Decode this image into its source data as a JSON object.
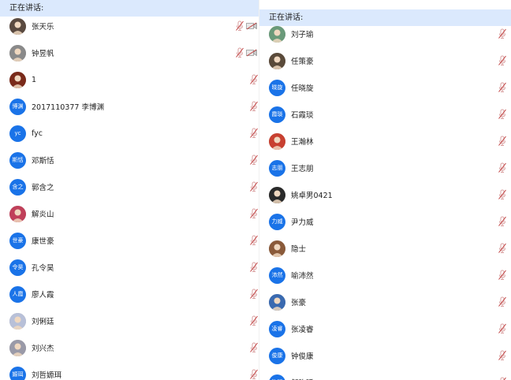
{
  "speaking_label": "正在讲话:",
  "left": {
    "members": [
      {
        "name": "张天乐",
        "avatar": {
          "type": "photo",
          "color": "#5a4a40"
        },
        "cam": true
      },
      {
        "name": "钟昱帆",
        "avatar": {
          "type": "photo",
          "color": "#8a8a8a"
        },
        "cam": true
      },
      {
        "name": "1",
        "avatar": {
          "type": "photo",
          "color": "#7a2a1a"
        },
        "cam": false
      },
      {
        "name": "2017110377 李博渊",
        "avatar": {
          "type": "text",
          "text": "博渊"
        },
        "cam": false
      },
      {
        "name": "fyc",
        "avatar": {
          "type": "text",
          "text": "yc"
        },
        "cam": false
      },
      {
        "name": "邓斯恬",
        "avatar": {
          "type": "text",
          "text": "斯恬"
        },
        "cam": false
      },
      {
        "name": "郭含之",
        "avatar": {
          "type": "text",
          "text": "含之"
        },
        "cam": false
      },
      {
        "name": "解炎山",
        "avatar": {
          "type": "photo",
          "color": "#c0405a"
        },
        "cam": false
      },
      {
        "name": "康世豪",
        "avatar": {
          "type": "text",
          "text": "世豪"
        },
        "cam": false
      },
      {
        "name": "孔令昊",
        "avatar": {
          "type": "text",
          "text": "令昊"
        },
        "cam": false
      },
      {
        "name": "廖人霞",
        "avatar": {
          "type": "text",
          "text": "人霞"
        },
        "cam": false
      },
      {
        "name": "刘俐廷",
        "avatar": {
          "type": "photo",
          "color": "#b8c0d8"
        },
        "cam": false
      },
      {
        "name": "刘兴杰",
        "avatar": {
          "type": "photo",
          "color": "#9a9aa8"
        },
        "cam": false
      },
      {
        "name": "刘哲嫄珥",
        "avatar": {
          "type": "text",
          "text": "嫄珥"
        },
        "cam": false
      }
    ]
  },
  "right": {
    "members": [
      {
        "name": "刘子瑜",
        "avatar": {
          "type": "photo",
          "color": "#6a9a7a"
        }
      },
      {
        "name": "任策豪",
        "avatar": {
          "type": "photo",
          "color": "#5a4a3a"
        }
      },
      {
        "name": "任晓旋",
        "avatar": {
          "type": "text",
          "text": "晓旋"
        }
      },
      {
        "name": "石霞琰",
        "avatar": {
          "type": "text",
          "text": "霞琰"
        }
      },
      {
        "name": "王瀚林",
        "avatar": {
          "type": "photo",
          "color": "#c84030"
        }
      },
      {
        "name": "王志朋",
        "avatar": {
          "type": "text",
          "text": "志朋"
        }
      },
      {
        "name": "姚卓男0421",
        "avatar": {
          "type": "photo",
          "color": "#2a2a2a"
        }
      },
      {
        "name": "尹力威",
        "avatar": {
          "type": "text",
          "text": "力威"
        }
      },
      {
        "name": "隐士",
        "avatar": {
          "type": "photo",
          "color": "#8a5a3a"
        }
      },
      {
        "name": "喻沛然",
        "avatar": {
          "type": "text",
          "text": "沛然"
        }
      },
      {
        "name": "张豪",
        "avatar": {
          "type": "photo",
          "color": "#3a6ab0"
        }
      },
      {
        "name": "张凌睿",
        "avatar": {
          "type": "text",
          "text": "凌睿"
        }
      },
      {
        "name": "钟俊康",
        "avatar": {
          "type": "text",
          "text": "俊康"
        }
      },
      {
        "name": "邹昀廷",
        "avatar": {
          "type": "text",
          "text": "昀廷"
        }
      }
    ]
  },
  "colors": {
    "accent": "#1a73e8",
    "speaking_bar": "#dbe9fd",
    "mic_muted": "#d9a0a0"
  }
}
